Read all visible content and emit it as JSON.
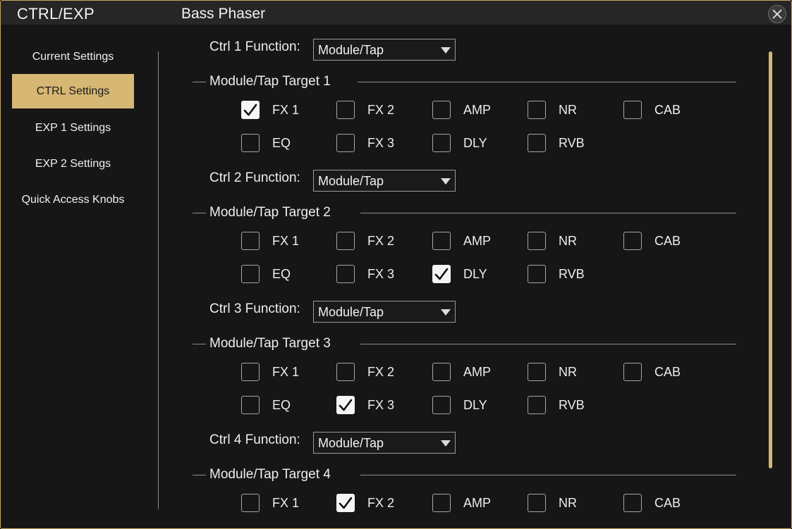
{
  "window": {
    "app_title": "CTRL/EXP",
    "preset_name": "Bass Phaser",
    "close_icon": "close-icon"
  },
  "sidebar": {
    "items": [
      {
        "label": "Current Settings"
      },
      {
        "label": "CTRL Settings",
        "active": true
      },
      {
        "label": "EXP 1 Settings"
      },
      {
        "label": "EXP 2 Settings"
      },
      {
        "label": "Quick Access Knobs"
      }
    ]
  },
  "ctrl": [
    {
      "function_label": "Ctrl 1 Function:",
      "function_value": "Module/Tap",
      "target_title": "Module/Tap Target 1",
      "checks": [
        {
          "label": "FX 1",
          "checked": true
        },
        {
          "label": "FX 2",
          "checked": false
        },
        {
          "label": "AMP",
          "checked": false
        },
        {
          "label": "NR",
          "checked": false
        },
        {
          "label": "CAB",
          "checked": false
        },
        {
          "label": "EQ",
          "checked": false
        },
        {
          "label": "FX 3",
          "checked": false
        },
        {
          "label": "DLY",
          "checked": false
        },
        {
          "label": "RVB",
          "checked": false
        }
      ]
    },
    {
      "function_label": "Ctrl 2 Function:",
      "function_value": "Module/Tap",
      "target_title": "Module/Tap Target 2",
      "checks": [
        {
          "label": "FX 1",
          "checked": false
        },
        {
          "label": "FX 2",
          "checked": false
        },
        {
          "label": "AMP",
          "checked": false
        },
        {
          "label": "NR",
          "checked": false
        },
        {
          "label": "CAB",
          "checked": false
        },
        {
          "label": "EQ",
          "checked": false
        },
        {
          "label": "FX 3",
          "checked": false
        },
        {
          "label": "DLY",
          "checked": true
        },
        {
          "label": "RVB",
          "checked": false
        }
      ]
    },
    {
      "function_label": "Ctrl 3 Function:",
      "function_value": "Module/Tap",
      "target_title": "Module/Tap Target 3",
      "checks": [
        {
          "label": "FX 1",
          "checked": false
        },
        {
          "label": "FX 2",
          "checked": false
        },
        {
          "label": "AMP",
          "checked": false
        },
        {
          "label": "NR",
          "checked": false
        },
        {
          "label": "CAB",
          "checked": false
        },
        {
          "label": "EQ",
          "checked": false
        },
        {
          "label": "FX 3",
          "checked": true
        },
        {
          "label": "DLY",
          "checked": false
        },
        {
          "label": "RVB",
          "checked": false
        }
      ]
    },
    {
      "function_label": "Ctrl 4 Function:",
      "function_value": "Module/Tap",
      "target_title": "Module/Tap Target 4",
      "checks": [
        {
          "label": "FX 1",
          "checked": false
        },
        {
          "label": "FX 2",
          "checked": true
        },
        {
          "label": "AMP",
          "checked": false
        },
        {
          "label": "NR",
          "checked": false
        },
        {
          "label": "CAB",
          "checked": false
        }
      ]
    }
  ],
  "colors": {
    "accent": "#d6b774",
    "background": "#161616",
    "title_bar": "#262626"
  },
  "icons": {
    "dropdown": "chevron-down-icon",
    "check": "checkmark-icon"
  }
}
